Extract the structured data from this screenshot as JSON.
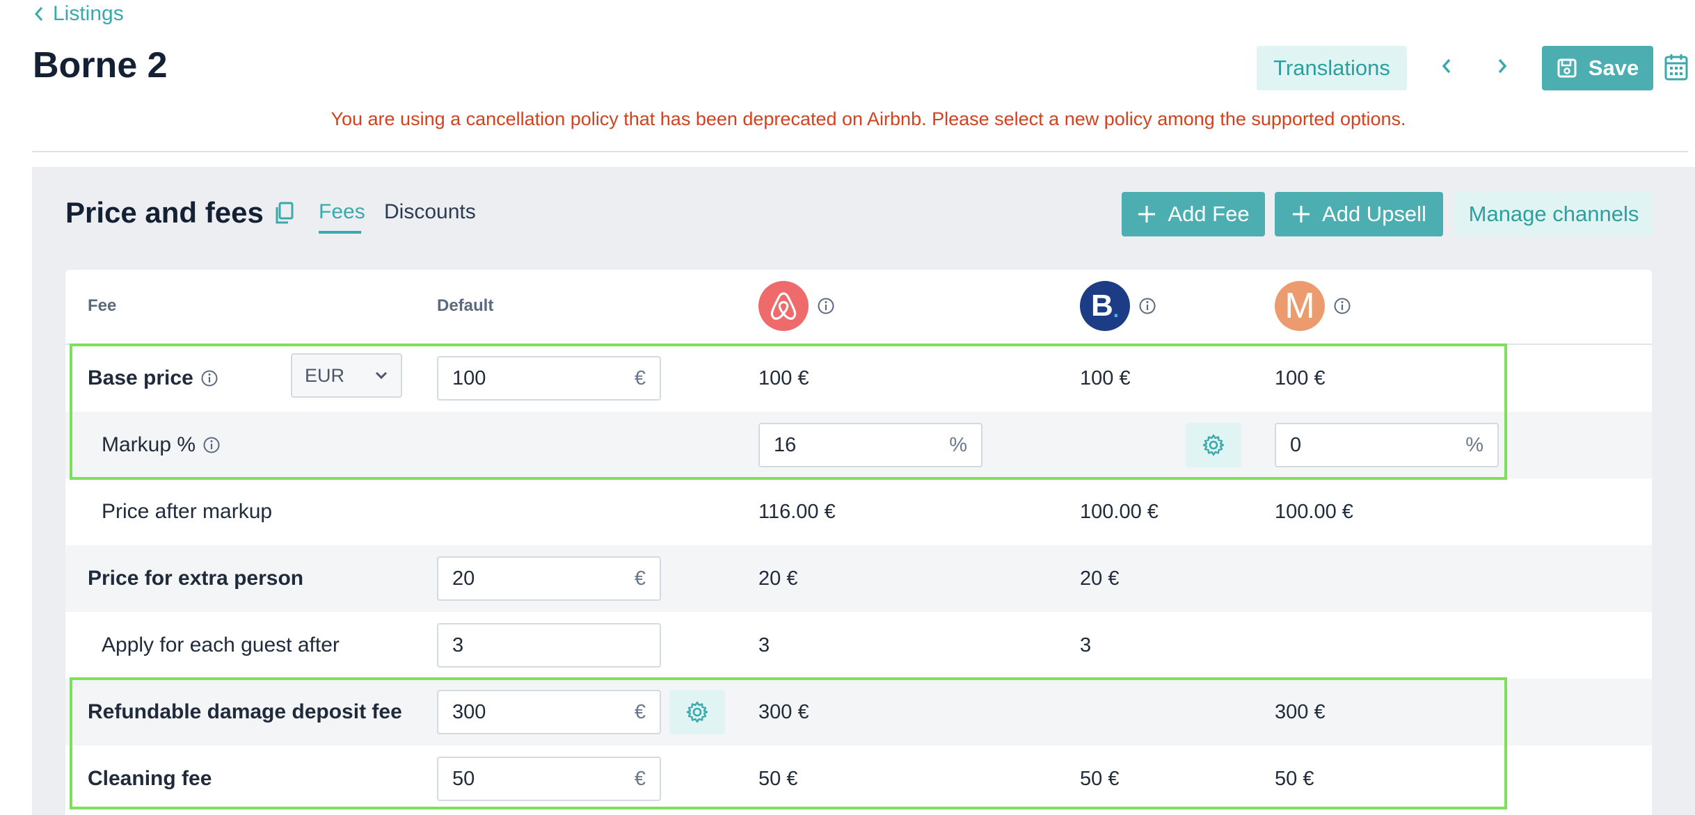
{
  "header": {
    "back_label": "Listings",
    "title": "Borne 2",
    "translations_label": "Translations",
    "save_label": "Save",
    "warning": "You are using a cancellation policy that has been deprecated on Airbnb. Please select a new policy among the supported options."
  },
  "panel": {
    "title": "Price and fees",
    "tabs": [
      "Fees",
      "Discounts"
    ],
    "add_fee_label": "Add Fee",
    "add_upsell_label": "Add Upsell",
    "manage_channels_label": "Manage channels"
  },
  "table": {
    "col_fee": "Fee",
    "col_default": "Default",
    "channels": [
      {
        "name": "airbnb",
        "color": "#ef6b6b"
      },
      {
        "name": "booking",
        "letter": "B",
        "color": "#1c3d86"
      },
      {
        "name": "m-channel",
        "letter": "M",
        "color": "#ec9b6e"
      }
    ],
    "rows": {
      "base_price": {
        "label": "Base price",
        "currency": "EUR",
        "default": "100",
        "unit": "€",
        "airbnb": "100 €",
        "booking": "100 €",
        "m": "100 €"
      },
      "markup": {
        "label": "Markup %",
        "airbnb": "16",
        "m": "0",
        "unit": "%"
      },
      "after_markup": {
        "label": "Price after markup",
        "airbnb": "116.00 €",
        "booking": "100.00 €",
        "m": "100.00 €"
      },
      "extra_person": {
        "label": "Price for extra person",
        "default": "20",
        "unit": "€",
        "airbnb": "20 €",
        "booking": "20 €"
      },
      "guest_after": {
        "label": "Apply for each guest after",
        "default": "3",
        "airbnb": "3",
        "booking": "3"
      },
      "deposit": {
        "label": "Refundable damage deposit fee",
        "default": "300",
        "unit": "€",
        "airbnb": "300 €",
        "m": "300 €"
      },
      "cleaning": {
        "label": "Cleaning fee",
        "default": "50",
        "unit": "€",
        "airbnb": "50 €",
        "booking": "50 €",
        "m": "50 €"
      }
    }
  },
  "colors": {
    "accent": "#4caeb0",
    "accent_light": "#dff4f3",
    "warning": "#d2421f",
    "highlight": "#7ee05a"
  }
}
